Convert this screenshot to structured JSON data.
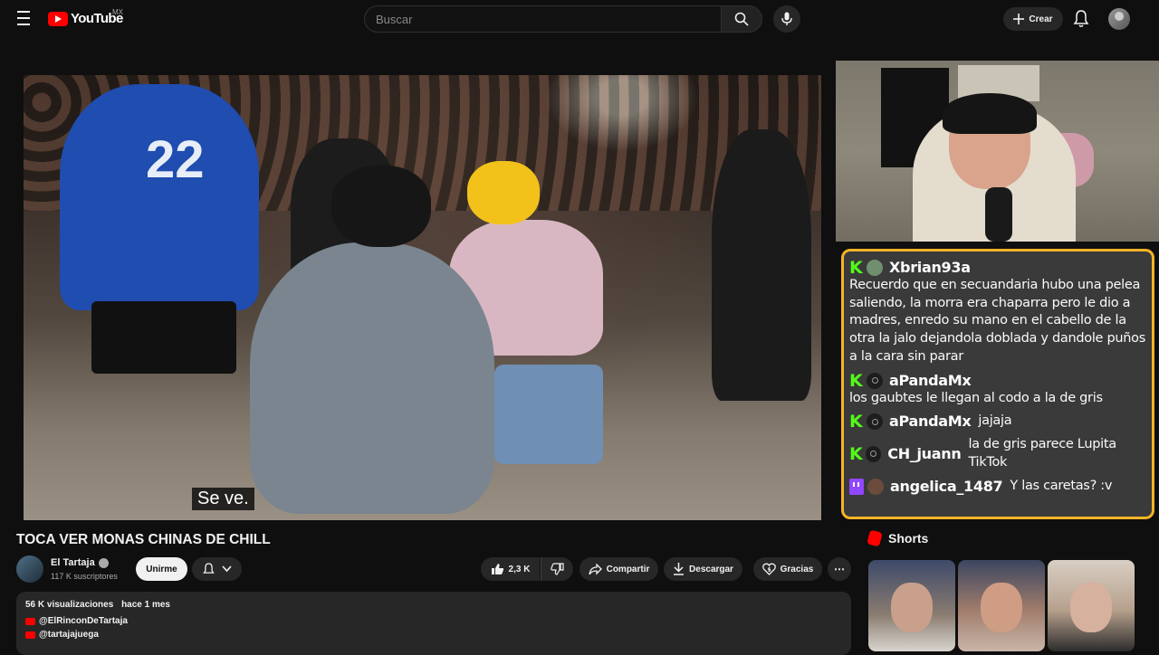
{
  "header": {
    "logo_text": "YouTube",
    "country_code": "MX",
    "search_placeholder": "Buscar",
    "create_label": "Crear"
  },
  "video": {
    "subtitle_text": "Se ve.",
    "jersey_number": "22",
    "title": "TOCA VER MONAS CHINAS DE CHILL"
  },
  "channel": {
    "name": "El Tartaja",
    "subscribers": "117 K suscriptores",
    "join_label": "Unirme"
  },
  "actions": {
    "likes": "2,3 K",
    "share_label": "Compartir",
    "download_label": "Descargar",
    "thanks_label": "Gracias"
  },
  "description": {
    "views": "56 K visualizaciones",
    "age": "hace 1 mes",
    "links": [
      "@ElRinconDeTartaja",
      "@tartajajuega"
    ]
  },
  "chat": {
    "messages": [
      {
        "platform": "kick",
        "user": "Xbrian93a",
        "text": "Recuerdo que en secuandaria hubo una pelea saliendo, la morra era chaparra pero le dio a madres, enredo su mano en el cabello de la otra la jalo dejandola doblada y dandole puños a la cara sin parar"
      },
      {
        "platform": "kick",
        "user": "aPandaMx",
        "text": "los gaubtes le llegan al codo a la de gris"
      },
      {
        "platform": "kick",
        "user": "aPandaMx",
        "text": "jajaja"
      },
      {
        "platform": "kick",
        "user": "CH_juann",
        "text": "la de gris parece Lupita TikTok"
      },
      {
        "platform": "twitch",
        "user": "angelica_1487",
        "text": "Y las caretas? :v"
      }
    ],
    "border_color": "#f4b426"
  },
  "shorts": {
    "heading": "Shorts"
  },
  "colors": {
    "brand_red": "#ff0000",
    "kick_green": "#53fc18",
    "twitch_purple": "#9146ff",
    "background": "#0f0f0f"
  }
}
